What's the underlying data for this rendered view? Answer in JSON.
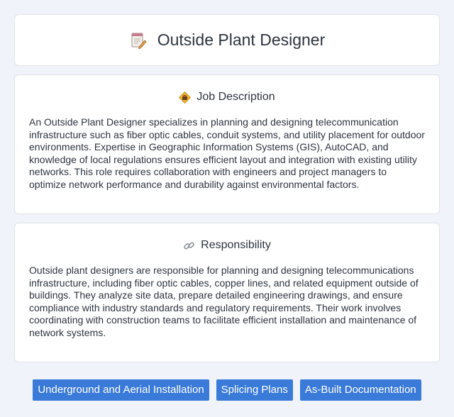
{
  "header": {
    "title": "Outside Plant Designer",
    "icon": "document-pencil-icon"
  },
  "job_description": {
    "title": "Job Description",
    "icon": "diamond-briefcase-icon",
    "text": "An Outside Plant Designer specializes in planning and designing telecommunication infrastructure such as fiber optic cables, conduit systems, and utility placement for outdoor environments. Expertise in Geographic Information Systems (GIS), AutoCAD, and knowledge of local regulations ensures efficient layout and integration with existing utility networks. This role requires collaboration with engineers and project managers to optimize network performance and durability against environmental factors."
  },
  "responsibility": {
    "title": "Responsibility",
    "icon": "link-icon",
    "text": "Outside plant designers are responsible for planning and designing telecommunications infrastructure, including fiber optic cables, copper lines, and related equipment outside of buildings. They analyze site data, prepare detailed engineering drawings, and ensure compliance with industry standards and regulatory requirements. Their work involves coordinating with construction teams to facilitate efficient installation and maintenance of network systems."
  },
  "tags": [
    "Underground and Aerial Installation",
    "Splicing Plans",
    "As-Built Documentation"
  ],
  "colors": {
    "background": "#f0f3f9",
    "card": "#ffffff",
    "tag": "#3a7ad9",
    "text": "#2d3540"
  }
}
